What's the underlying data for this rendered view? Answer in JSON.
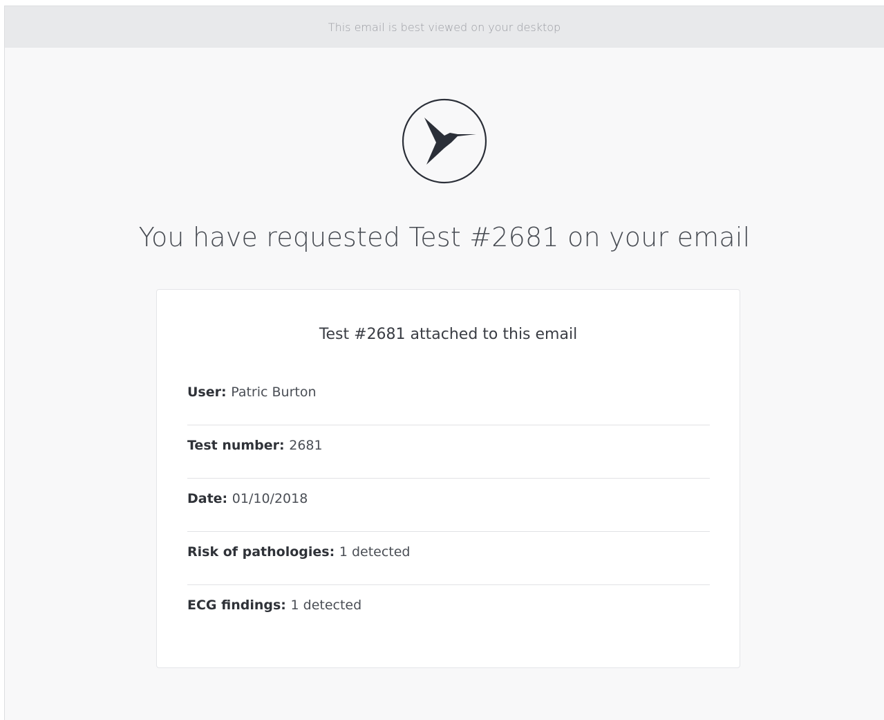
{
  "preheader": {
    "text": "This email is best viewed on your desktop"
  },
  "logo": {
    "icon": "hummingbird-icon",
    "color": "#2b2f38"
  },
  "headline": "You have requested Test #2681 on your email",
  "card": {
    "title": "Test #2681 attached to this email",
    "rows": [
      {
        "label": "User:",
        "value": "Patric Burton"
      },
      {
        "label": "Test number:",
        "value": "2681"
      },
      {
        "label": "Date:",
        "value": "01/10/2018"
      },
      {
        "label": "Risk of pathologies:",
        "value": "1 detected"
      },
      {
        "label": "ECG findings:",
        "value": "1 detected"
      }
    ]
  }
}
